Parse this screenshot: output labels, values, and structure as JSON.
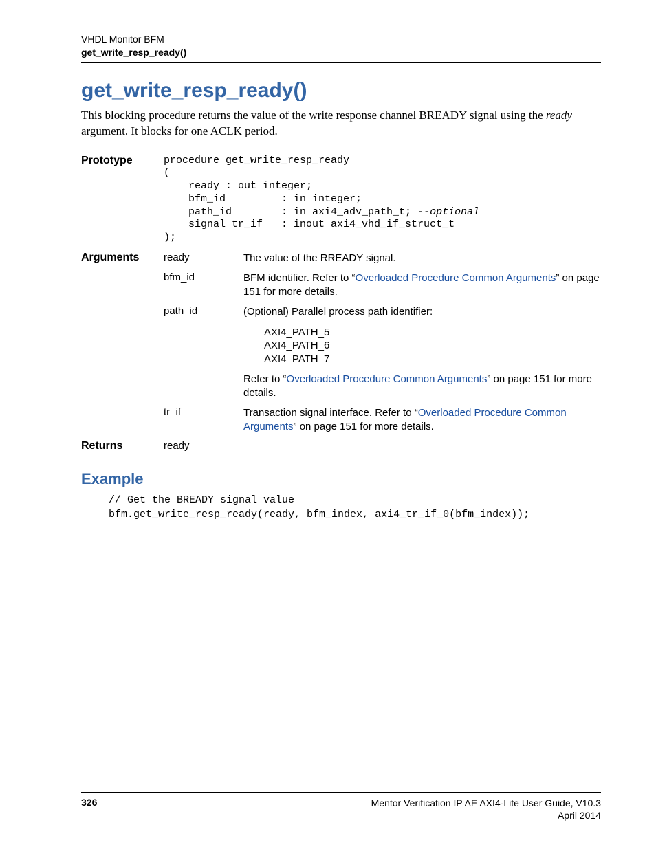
{
  "header": {
    "line1": "VHDL Monitor BFM",
    "line2": "get_write_resp_ready()"
  },
  "title": "get_write_resp_ready()",
  "intro": {
    "pre": "This blocking procedure returns the value of the write response channel BREADY signal using the ",
    "ital": "ready",
    "post": " argument. It blocks for one ACLK period."
  },
  "labels": {
    "prototype": "Prototype",
    "arguments": "Arguments",
    "returns": "Returns"
  },
  "prototype": {
    "l1": "procedure get_write_resp_ready",
    "l2": "(",
    "l3": "    ready : out integer;",
    "l4": "    bfm_id         : in integer;",
    "l5a": "    path_id        : in axi4_adv_path_t; ",
    "l5b": "--optional",
    "l6": "    signal tr_if   : inout axi4_vhd_if_struct_t",
    "l7": ");"
  },
  "args": {
    "ready": {
      "name": "ready",
      "desc": "The value of the RREADY signal."
    },
    "bfm_id": {
      "name": "bfm_id",
      "pre": "BFM identifier. Refer to “",
      "link": "Overloaded Procedure Common Arguments",
      "post": "” on page 151 for more details."
    },
    "path_id": {
      "name": "path_id",
      "lead": "(Optional) Parallel process path identifier:",
      "opts": {
        "a": "AXI4_PATH_5",
        "b": "AXI4_PATH_6",
        "c": "AXI4_PATH_7"
      },
      "tail_pre": "Refer to “",
      "tail_link": "Overloaded Procedure Common Arguments",
      "tail_post": "” on page 151 for more details."
    },
    "tr_if": {
      "name": "tr_if",
      "pre": "Transaction signal interface. Refer to “",
      "link": "Overloaded Procedure Common Arguments",
      "post": "” on page 151 for more details."
    }
  },
  "returns_value": "ready",
  "example_heading": "Example",
  "example_code": {
    "l1": "// Get the BREADY signal value",
    "l2": "bfm.get_write_resp_ready(ready, bfm_index, axi4_tr_if_0(bfm_index));"
  },
  "footer": {
    "page": "326",
    "right1": "Mentor Verification IP AE AXI4-Lite User Guide, V10.3",
    "right2": "April 2014"
  }
}
